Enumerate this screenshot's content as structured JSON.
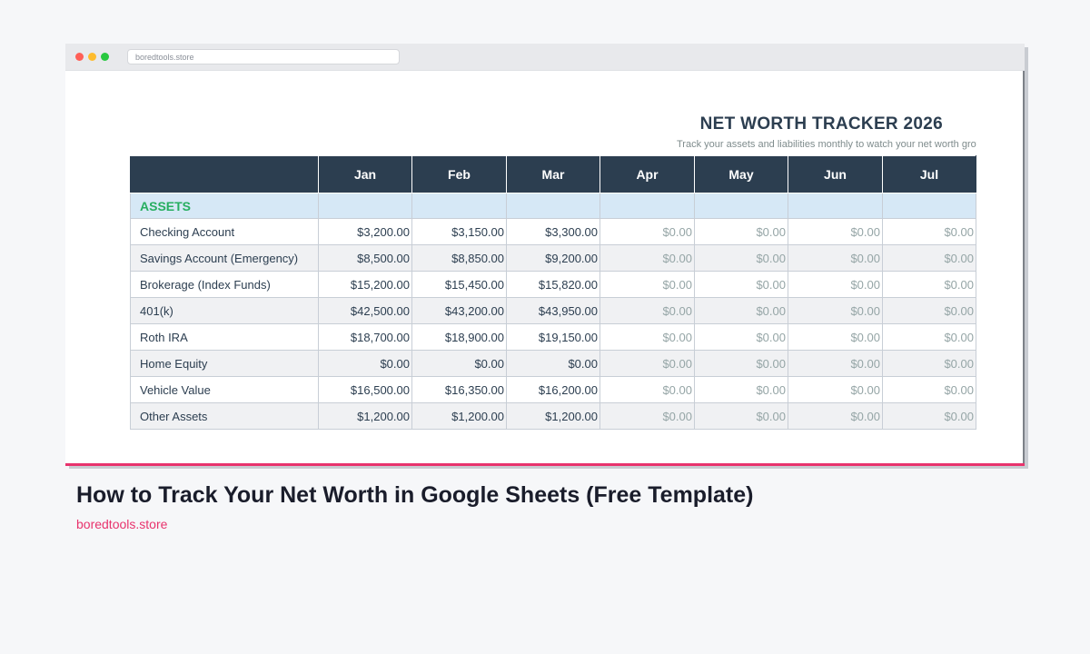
{
  "browser": {
    "url": "boredtools.store"
  },
  "sheet": {
    "title": "NET WORTH TRACKER 2026",
    "subtitle": "Track your assets and liabilities monthly to watch your net worth grow",
    "months": [
      "Jan",
      "Feb",
      "Mar",
      "Apr",
      "May",
      "Jun",
      "Jul"
    ],
    "section_label": "ASSETS",
    "rows": [
      {
        "label": "Checking Account",
        "values": [
          "$3,200.00",
          "$3,150.00",
          "$3,300.00",
          "$0.00",
          "$0.00",
          "$0.00",
          "$0.00"
        ]
      },
      {
        "label": "Savings Account (Emergency)",
        "values": [
          "$8,500.00",
          "$8,850.00",
          "$9,200.00",
          "$0.00",
          "$0.00",
          "$0.00",
          "$0.00"
        ]
      },
      {
        "label": "Brokerage (Index Funds)",
        "values": [
          "$15,200.00",
          "$15,450.00",
          "$15,820.00",
          "$0.00",
          "$0.00",
          "$0.00",
          "$0.00"
        ]
      },
      {
        "label": "401(k)",
        "values": [
          "$42,500.00",
          "$43,200.00",
          "$43,950.00",
          "$0.00",
          "$0.00",
          "$0.00",
          "$0.00"
        ]
      },
      {
        "label": "Roth IRA",
        "values": [
          "$18,700.00",
          "$18,900.00",
          "$19,150.00",
          "$0.00",
          "$0.00",
          "$0.00",
          "$0.00"
        ]
      },
      {
        "label": "Home Equity",
        "values": [
          "$0.00",
          "$0.00",
          "$0.00",
          "$0.00",
          "$0.00",
          "$0.00",
          "$0.00"
        ]
      },
      {
        "label": "Vehicle Value",
        "values": [
          "$16,500.00",
          "$16,350.00",
          "$16,200.00",
          "$0.00",
          "$0.00",
          "$0.00",
          "$0.00"
        ]
      },
      {
        "label": "Other Assets",
        "values": [
          "$1,200.00",
          "$1,200.00",
          "$1,200.00",
          "$0.00",
          "$0.00",
          "$0.00",
          "$0.00"
        ]
      }
    ]
  },
  "article": {
    "headline": "How to Track Your Net Worth in Google Sheets (Free Template)",
    "site": "boredtools.store"
  },
  "colors": {
    "header_bg": "#2c3e50",
    "section_bg": "#d6e8f6",
    "section_text": "#27ae60",
    "accent": "#e8336d"
  }
}
